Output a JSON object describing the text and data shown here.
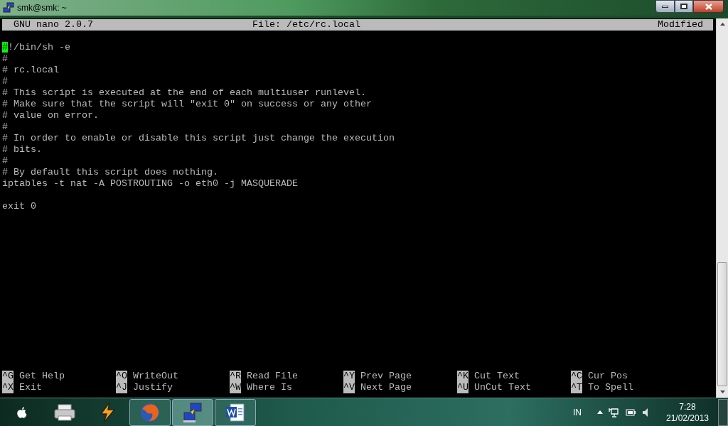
{
  "window": {
    "title": "smk@smk: ~"
  },
  "editor": {
    "header": {
      "app": "GNU nano 2.0.7",
      "file": "File: /etc/rc.local",
      "status": "Modified"
    },
    "lines": [
      {
        "kind": "blank"
      },
      {
        "kind": "text",
        "text": "#!/bin/sh -e",
        "cursor": true
      },
      {
        "kind": "text",
        "text": "#",
        "cursor": false
      },
      {
        "kind": "text",
        "text": "# rc.local",
        "cursor": false
      },
      {
        "kind": "text",
        "text": "#",
        "cursor": false
      },
      {
        "kind": "text",
        "text": "# This script is executed at the end of each multiuser runlevel.",
        "cursor": false
      },
      {
        "kind": "text",
        "text": "# Make sure that the script will \"exit 0\" on success or any other",
        "cursor": false
      },
      {
        "kind": "text",
        "text": "# value on error.",
        "cursor": false
      },
      {
        "kind": "text",
        "text": "#",
        "cursor": false
      },
      {
        "kind": "text",
        "text": "# In order to enable or disable this script just change the execution",
        "cursor": false
      },
      {
        "kind": "text",
        "text": "# bits.",
        "cursor": false
      },
      {
        "kind": "text",
        "text": "#",
        "cursor": false
      },
      {
        "kind": "text",
        "text": "# By default this script does nothing.",
        "cursor": false
      },
      {
        "kind": "text",
        "text": "iptables -t nat -A POSTROUTING -o eth0 -j MASQUERADE",
        "cursor": false
      },
      {
        "kind": "blank"
      },
      {
        "kind": "text",
        "text": "exit 0",
        "cursor": false
      }
    ],
    "shortcuts": [
      {
        "key": "^G",
        "label": "Get Help"
      },
      {
        "key": "^X",
        "label": "Exit"
      },
      {
        "key": "^O",
        "label": "WriteOut"
      },
      {
        "key": "^J",
        "label": "Justify"
      },
      {
        "key": "^R",
        "label": "Read File"
      },
      {
        "key": "^W",
        "label": "Where Is"
      },
      {
        "key": "^Y",
        "label": "Prev Page"
      },
      {
        "key": "^V",
        "label": "Next Page"
      },
      {
        "key": "^K",
        "label": "Cut Text"
      },
      {
        "key": "^U",
        "label": "UnCut Text"
      },
      {
        "key": "^C",
        "label": "Cur Pos"
      },
      {
        "key": "^T",
        "label": "To Spell"
      }
    ]
  },
  "taskbar": {
    "apps": [
      {
        "kind": "printer",
        "running": false,
        "selected": false
      },
      {
        "kind": "bolt",
        "running": false,
        "selected": false
      },
      {
        "kind": "browser",
        "running": true,
        "selected": false
      },
      {
        "kind": "terminal",
        "running": true,
        "selected": true
      },
      {
        "kind": "document",
        "running": true,
        "selected": false
      }
    ],
    "language": "IN",
    "time": "7:28",
    "date": "21/02/2013"
  }
}
